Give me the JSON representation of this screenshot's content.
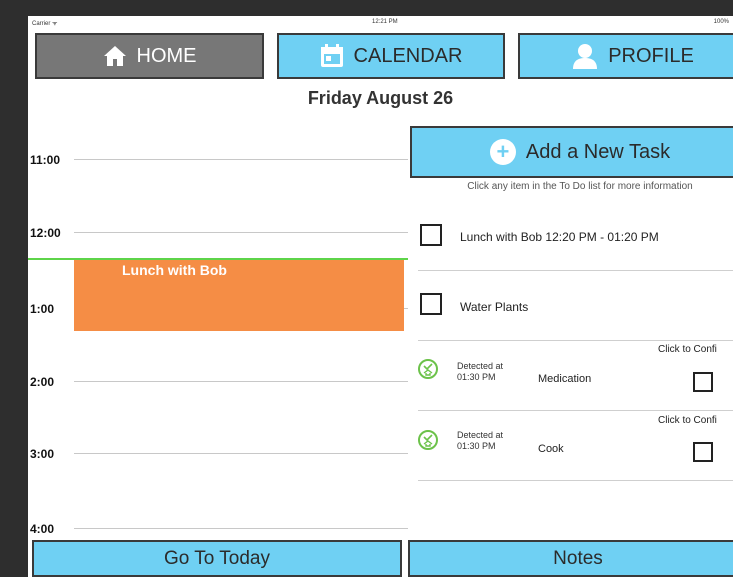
{
  "status_bar": {
    "carrier": "Carrier ᯤ",
    "time": "12:21 PM",
    "battery": "100%"
  },
  "nav": {
    "home_label": "HOME",
    "calendar_label": "CALENDAR",
    "profile_label": "PROFILE"
  },
  "date_title": "Friday August 26",
  "timeline": {
    "hours": [
      "11:00",
      "12:00",
      "1:00",
      "2:00",
      "3:00",
      "4:00"
    ],
    "event": {
      "title": "Lunch with Bob"
    }
  },
  "tasks_panel": {
    "add_label": "Add a New Task",
    "hint": "Click any item in the To Do list for more information",
    "todo_items": [
      {
        "label": "Lunch with Bob 12:20 PM - 01:20 PM"
      },
      {
        "label": "Water Plants"
      }
    ],
    "detected_items": [
      {
        "detected_label": "Detected at",
        "detected_time": "01:30 PM",
        "name": "Medication",
        "confirm_label": "Click to Confi"
      },
      {
        "detected_label": "Detected at",
        "detected_time": "01:30 PM",
        "name": "Cook",
        "confirm_label": "Click to Confi"
      }
    ]
  },
  "bottom": {
    "today_label": "Go To Today",
    "notes_label": "Notes"
  },
  "colors": {
    "accent": "#6fd0f3",
    "event": "#f58d45",
    "now_line": "#5ed44a",
    "home_bg": "#777777"
  }
}
